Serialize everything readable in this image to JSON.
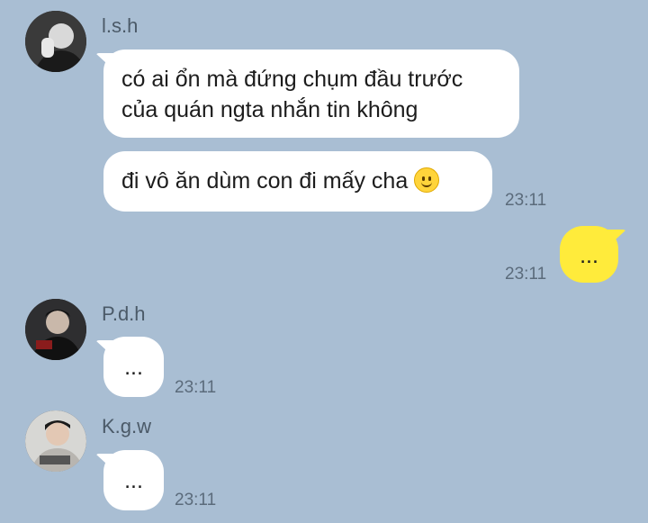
{
  "messages": [
    {
      "sender": "l.s.h",
      "bubbles": [
        "có ai ổn mà đứng chụm đầu trước",
        "của quán ngta nhắn tin không",
        "đi vô ăn dùm con đi mấy cha"
      ],
      "emoji": "slightly-smiling-face",
      "time": "23:11"
    },
    {
      "sender": "me",
      "text": "...",
      "time": "23:11"
    },
    {
      "sender": "P.d.h",
      "text": "...",
      "time": "23:11"
    },
    {
      "sender": "K.g.w",
      "text": "...",
      "time": "23:11"
    }
  ],
  "colors": {
    "background": "#a9bed3",
    "incoming_bubble": "#ffffff",
    "outgoing_bubble": "#ffeb3b"
  }
}
